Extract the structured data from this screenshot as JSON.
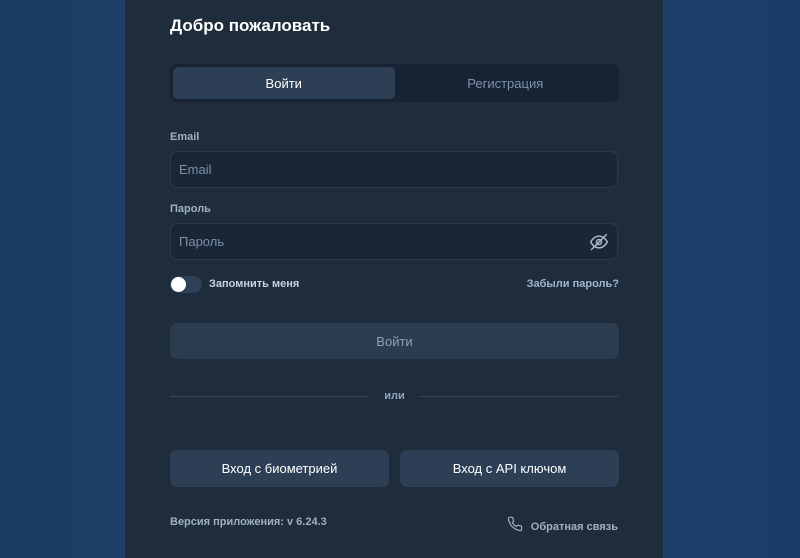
{
  "header": {
    "title": "Добро пожаловать"
  },
  "tabs": [
    {
      "label": "Войти",
      "active": true
    },
    {
      "label": "Регистрация",
      "active": false
    }
  ],
  "form": {
    "email_label": "Email",
    "email_placeholder": "Email",
    "email_value": "",
    "password_label": "Пароль",
    "password_placeholder": "Пароль",
    "password_value": "",
    "remember_label": "Запомнить меня",
    "remember_checked": false,
    "forgot_label": "Забыли пароль?",
    "submit_label": "Войти"
  },
  "divider": {
    "label": "или"
  },
  "alt_login": {
    "biometric_label": "Вход с биометрией",
    "api_key_label": "Вход с API ключом"
  },
  "footer": {
    "version": "Версия приложения: v 6.24.3",
    "feedback_label": "Обратная связь"
  },
  "icons": {
    "password_toggle": "eye-off-icon",
    "feedback": "phone-icon"
  },
  "colors": {
    "panel": "#1e2c3c",
    "background": "#1f4473",
    "input_bg": "#192636",
    "button_bg": "#2d3f55"
  }
}
